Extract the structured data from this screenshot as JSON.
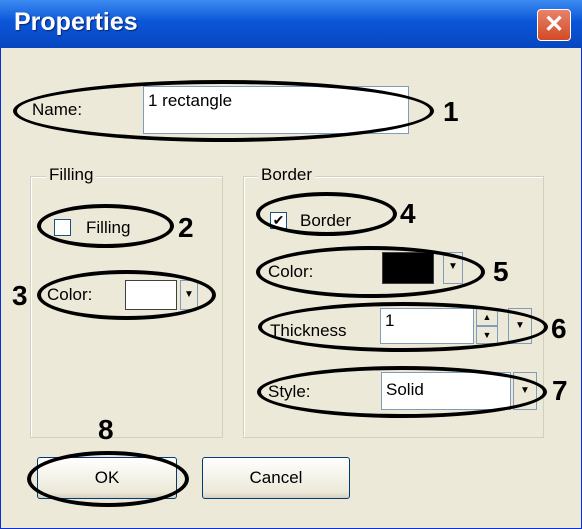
{
  "window": {
    "title": "Properties",
    "close_glyph": "✕"
  },
  "name_row": {
    "label": "Name:",
    "value": "1 rectangle"
  },
  "filling_group": {
    "legend": "Filling",
    "checkbox_label": "Filling",
    "checked": false,
    "color_label": "Color:",
    "color_value": "#ffffff"
  },
  "border_group": {
    "legend": "Border",
    "checkbox_label": "Border",
    "checked": true,
    "check_glyph": "✔",
    "color_label": "Color:",
    "color_value": "#000000",
    "thickness_label": "Thickness",
    "thickness_value": "1",
    "style_label": "Style:",
    "style_value": "Solid"
  },
  "dropdown_glyph": "▼",
  "spin_up": "▲",
  "spin_down": "▼",
  "buttons": {
    "ok": "OK",
    "cancel": "Cancel"
  },
  "callouts": [
    "1",
    "2",
    "3",
    "4",
    "5",
    "6",
    "7",
    "8"
  ]
}
